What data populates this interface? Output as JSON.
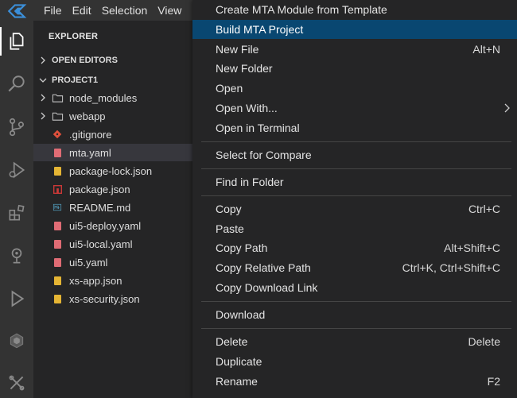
{
  "menubar": {
    "items": [
      "File",
      "Edit",
      "Selection",
      "View"
    ]
  },
  "explorer": {
    "title": "EXPLORER",
    "open_editors": "OPEN EDITORS",
    "project": "PROJECT1",
    "items": [
      {
        "label": "node_modules",
        "kind": "folder"
      },
      {
        "label": "webapp",
        "kind": "folder"
      },
      {
        "label": ".gitignore",
        "kind": "git",
        "color": "#e0503c"
      },
      {
        "label": "mta.yaml",
        "kind": "yaml",
        "color": "#e06c75"
      },
      {
        "label": "package-lock.json",
        "kind": "json",
        "color": "#e5b534"
      },
      {
        "label": "package.json",
        "kind": "npm",
        "color": "#cb3837"
      },
      {
        "label": "README.md",
        "kind": "md",
        "color": "#519aba"
      },
      {
        "label": "ui5-deploy.yaml",
        "kind": "yaml",
        "color": "#e06c75"
      },
      {
        "label": "ui5-local.yaml",
        "kind": "yaml",
        "color": "#e06c75"
      },
      {
        "label": "ui5.yaml",
        "kind": "yaml",
        "color": "#e06c75"
      },
      {
        "label": "xs-app.json",
        "kind": "json",
        "color": "#e5b534"
      },
      {
        "label": "xs-security.json",
        "kind": "json",
        "color": "#e5b534"
      }
    ]
  },
  "context_menu": {
    "items": [
      {
        "label": "Create MTA Module from Template",
        "shortcut": ""
      },
      {
        "label": "Build MTA Project",
        "shortcut": ""
      },
      {
        "label": "New File",
        "shortcut": "Alt+N"
      },
      {
        "label": "New Folder",
        "shortcut": ""
      },
      {
        "label": "Open",
        "shortcut": ""
      },
      {
        "label": "Open With...",
        "shortcut": ""
      },
      {
        "label": "Open in Terminal",
        "shortcut": ""
      },
      {
        "label": "Select for Compare",
        "shortcut": ""
      },
      {
        "label": "Find in Folder",
        "shortcut": ""
      },
      {
        "label": "Copy",
        "shortcut": "Ctrl+C"
      },
      {
        "label": "Paste",
        "shortcut": ""
      },
      {
        "label": "Copy Path",
        "shortcut": "Alt+Shift+C"
      },
      {
        "label": "Copy Relative Path",
        "shortcut": "Ctrl+K, Ctrl+Shift+C"
      },
      {
        "label": "Copy Download Link",
        "shortcut": ""
      },
      {
        "label": "Download",
        "shortcut": ""
      },
      {
        "label": "Delete",
        "shortcut": "Delete"
      },
      {
        "label": "Duplicate",
        "shortcut": ""
      },
      {
        "label": "Rename",
        "shortcut": "F2"
      }
    ],
    "highlighted_item": "Build MTA Project",
    "highlight_color": "#094771"
  },
  "activity_bar": {
    "icons": [
      "logo-icon",
      "explorer-icon",
      "search-icon",
      "source-control-icon",
      "run-debug-icon",
      "extensions-icon",
      "cloud-icon",
      "run-icon",
      "plugin-icon",
      "tools-icon"
    ],
    "active": "explorer-icon"
  }
}
